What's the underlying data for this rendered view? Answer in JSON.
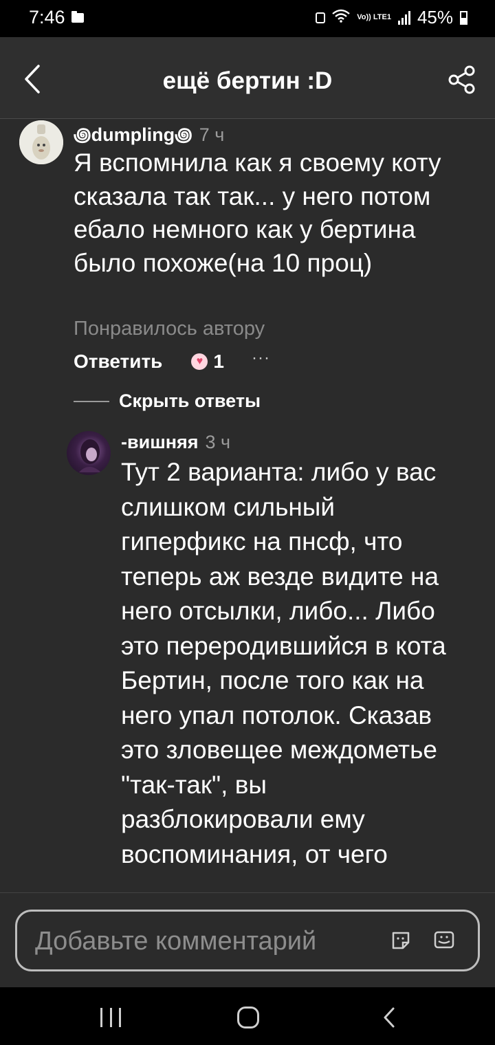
{
  "status_bar": {
    "time": "7:46",
    "network": "Vo)) LTE1",
    "battery": "45%",
    "battery_level": 0.45
  },
  "header": {
    "title": "ещё бертин :D",
    "back_icon": "chevron-left-icon",
    "share_icon": "share-icon"
  },
  "comment": {
    "author": "꩜dumpling꩜",
    "time": "7 ч",
    "text": "Я вспомнила как я своему коту сказала так так... у него потом ебало немного как у бертина было похоже(на 10 проц)",
    "liked_by_author": "Понравилось автору",
    "reply_label": "Ответить",
    "like_count": "1",
    "more_label": "···",
    "hide_replies_label": "Скрыть ответы"
  },
  "reply": {
    "author": "-вишняя",
    "time": "3 ч",
    "text": "Тут 2 варианта: либо у вас слишком сильный гиперфикс на пнсф, что теперь аж везде видите на него отсылки, либо... Либо это переродившийся в кота Бертин, после того как на него упал потолок. Сказав это зловещее междометье \"так-так\", вы разблокировали ему воспоминания, от чего"
  },
  "comment_input": {
    "placeholder": "Добавьте комментарий"
  },
  "colors": {
    "background": "#2b2b2b",
    "text": "#ffffff",
    "muted": "#8a8a8a",
    "heart": "#e0476b"
  }
}
